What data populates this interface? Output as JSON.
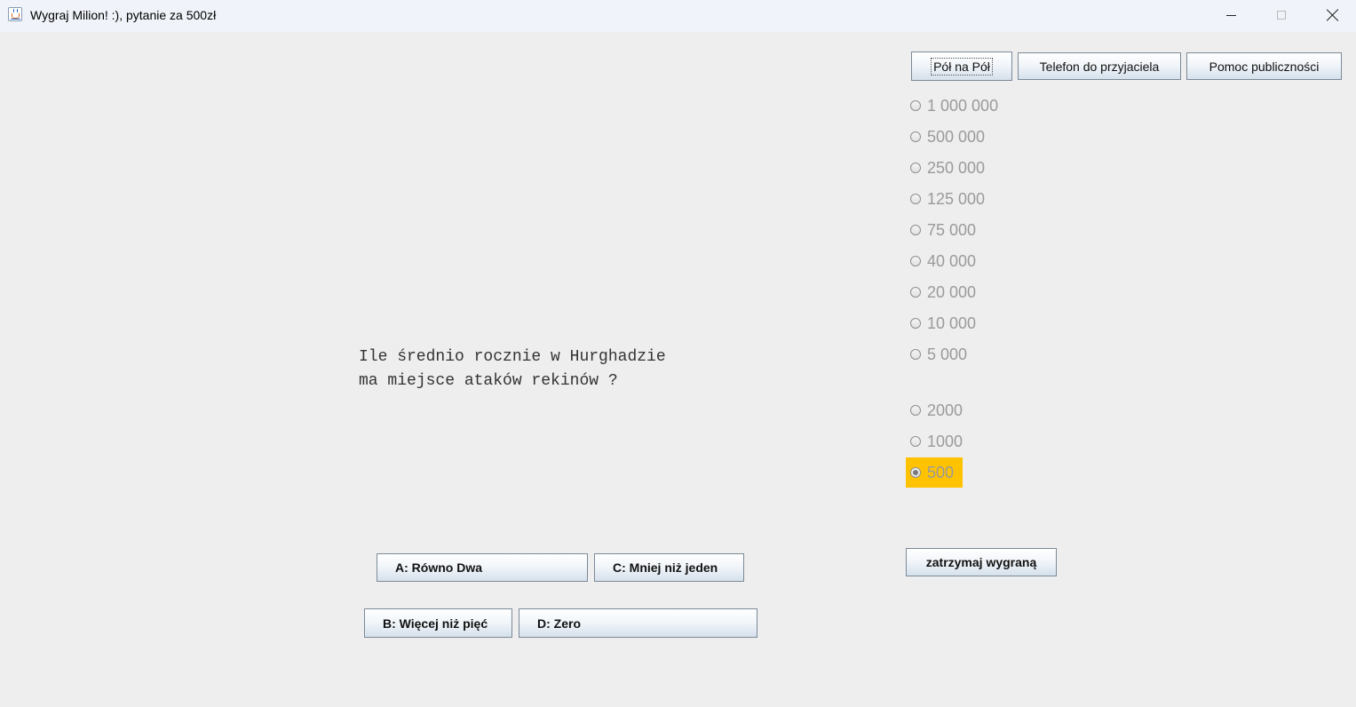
{
  "window": {
    "title": "Wygraj Milion! :), pytanie za 500zł",
    "controls": {
      "minimize": "—",
      "maximize": "□",
      "close": "✕"
    }
  },
  "lifelines": {
    "fifty_fifty": "Pół na Pół",
    "phone_friend": "Telefon do przyjaciela",
    "audience": "Pomoc publiczności"
  },
  "prize_ladder": [
    {
      "label": "1 000 000",
      "selected": false
    },
    {
      "label": "500 000",
      "selected": false
    },
    {
      "label": "250 000",
      "selected": false
    },
    {
      "label": "125 000",
      "selected": false
    },
    {
      "label": "75 000",
      "selected": false
    },
    {
      "label": "40 000",
      "selected": false
    },
    {
      "label": "20 000",
      "selected": false
    },
    {
      "label": "10 000",
      "selected": false
    },
    {
      "label": "5 000",
      "selected": false
    },
    {
      "label": "2000",
      "selected": false
    },
    {
      "label": "1000",
      "selected": false
    },
    {
      "label": "500",
      "selected": true
    }
  ],
  "current_prize_highlight_color": "#ffc200",
  "question": {
    "line1": "Ile średnio rocznie w Hurghadzie",
    "line2": "ma miejsce ataków rekinów ?"
  },
  "answers": {
    "a": "A: Równo Dwa",
    "b": "B: Więcej niż pięć",
    "c": "C: Mniej niż jeden",
    "d": "D: Zero"
  },
  "stop_button": "zatrzymaj wygraną"
}
